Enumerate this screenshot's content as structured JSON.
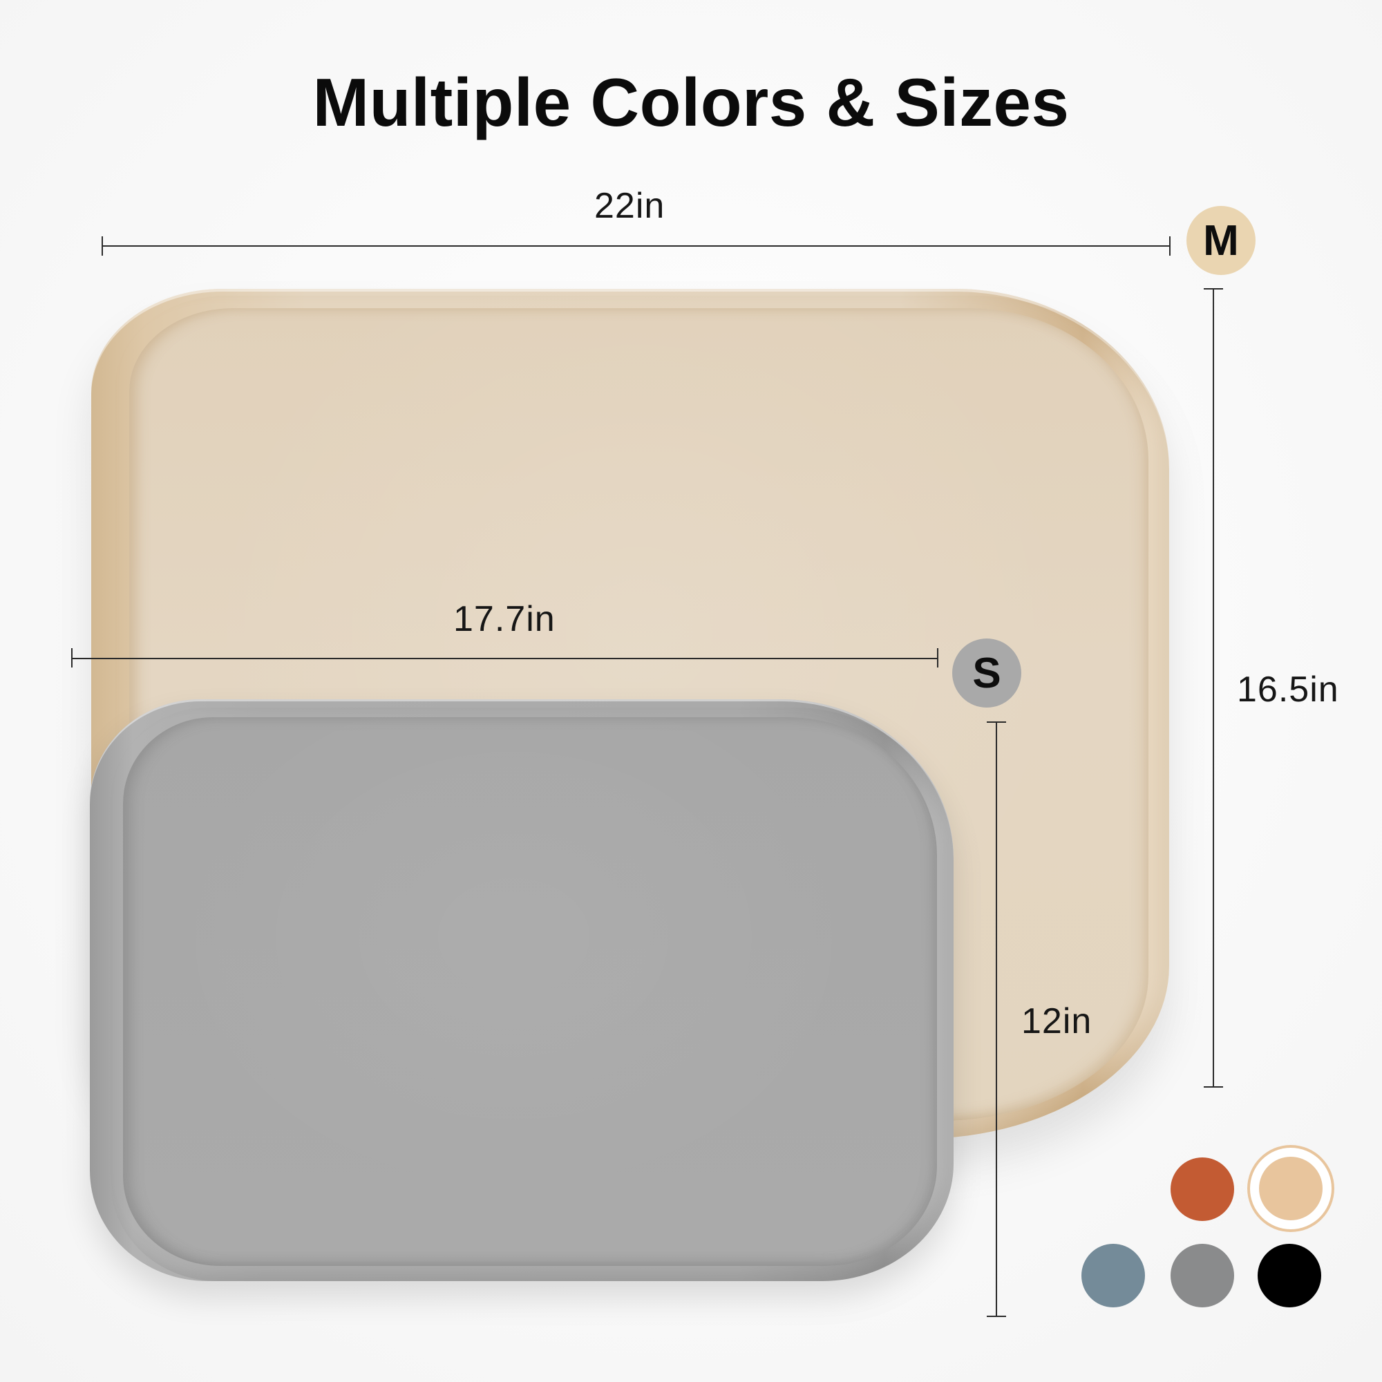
{
  "title": "Multiple Colors & Sizes",
  "sizes": {
    "medium": {
      "badge": "M",
      "width_label": "22in",
      "height_label": "16.5in"
    },
    "small": {
      "badge": "S",
      "width_label": "17.7in",
      "height_label": "12in"
    }
  },
  "colors": {
    "tray_medium": "#e3d4be",
    "tray_small": "#aaaaaa",
    "badge_medium": "#ead5b1",
    "badge_small": "#a9a9a9",
    "swatches": [
      "#c35b33",
      "#e8c59d",
      "#748b99",
      "#8a8b8c",
      "#000000"
    ]
  },
  "selected_swatch": "#e8c59d",
  "icons": {
    "size_badge": "size-badge-icon",
    "swatch": "color-swatch-icon"
  }
}
